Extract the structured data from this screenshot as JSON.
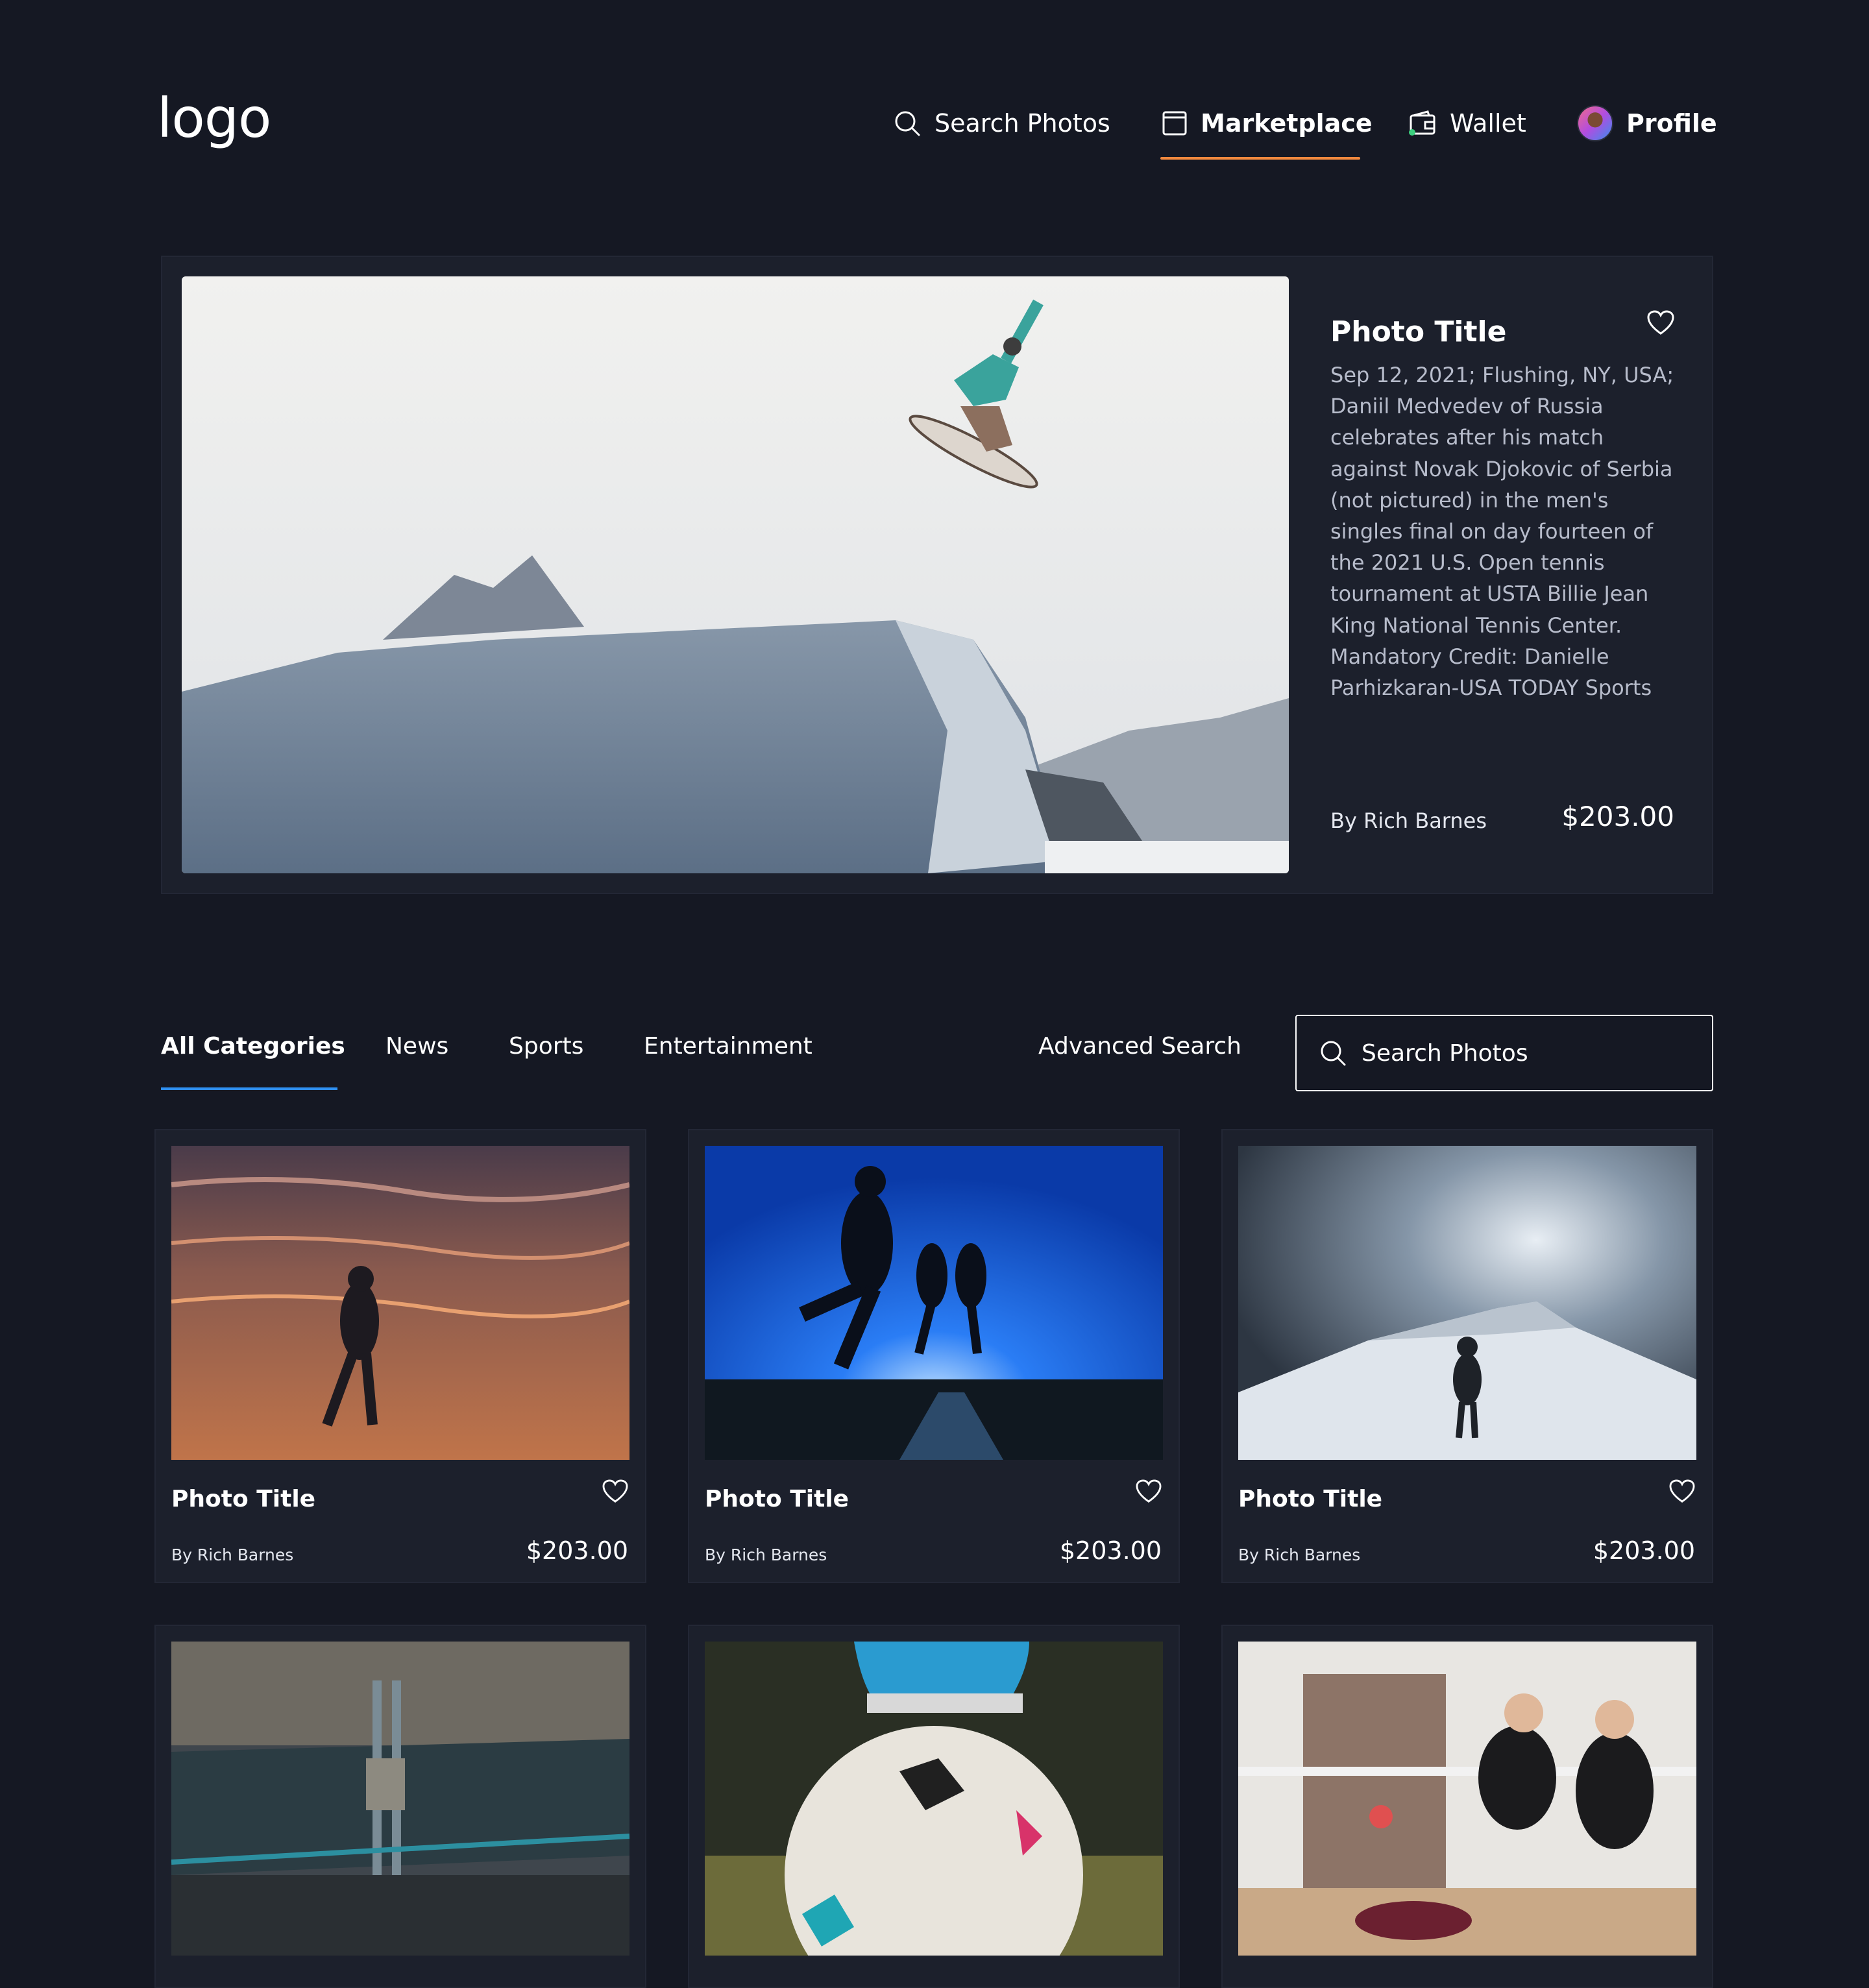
{
  "header": {
    "logo": "logo",
    "nav": [
      {
        "label": "Search Photos",
        "icon": "search-icon"
      },
      {
        "label": "Marketplace",
        "icon": "marketplace-icon",
        "active": true
      },
      {
        "label": "Wallet",
        "icon": "wallet-icon"
      },
      {
        "label": "Profile",
        "icon": "avatar"
      }
    ],
    "accent_color": "#f0883e"
  },
  "hero": {
    "title": "Photo Title",
    "description": "Sep 12, 2021; Flushing, NY, USA; Daniil Medvedev of Russia celebrates after his match against Novak Djokovic of Serbia (not pictured) in the men's singles final on day fourteen of the 2021 U.S. Open tennis tournament at USTA Billie Jean King National Tennis Center. Mandatory Credit: Danielle Parhizkaran-USA TODAY Sports",
    "author": "By Rich Barnes",
    "price": "$203.00",
    "image": "snowboarder-jump-photo"
  },
  "filters": {
    "tabs": [
      "All Categories",
      "News",
      "Sports",
      "Entertainment"
    ],
    "active_tab": "All Categories",
    "tab_accent_color": "#2f8ff0",
    "advanced_search": "Advanced Search",
    "search_placeholder": "Search Photos"
  },
  "cards": [
    {
      "title": "Photo Title",
      "author": "By Rich Barnes",
      "price": "$203.00",
      "image": "beach-runner-sunset-photo"
    },
    {
      "title": "Photo Title",
      "author": "By Rich Barnes",
      "price": "$203.00",
      "image": "runners-silhouette-photo"
    },
    {
      "title": "Photo Title",
      "author": "By Rich Barnes",
      "price": "$203.00",
      "image": "snow-hiker-photo"
    },
    {
      "image": "tower-bridge-aerial-photo"
    },
    {
      "image": "soccer-ball-cleat-photo"
    },
    {
      "image": "volleyball-players-photo"
    }
  ]
}
